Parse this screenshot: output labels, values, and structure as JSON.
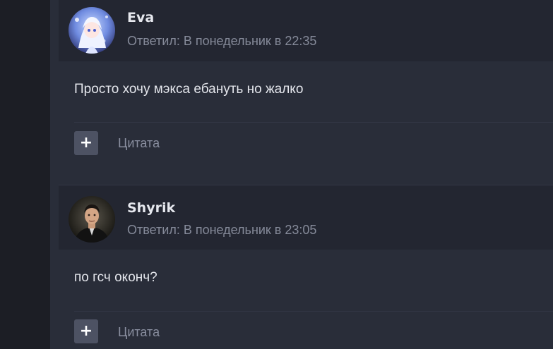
{
  "posts": [
    {
      "author": "Eva",
      "replied": "Ответил: В понедельник в 22:35",
      "message": "Просто хочу мэкса ебануть но жалко",
      "plus_label": "+",
      "quote_label": "Цитата"
    },
    {
      "author": "Shyrik",
      "replied": "Ответил: В понедельник в 23:05",
      "message": "по гсч оконч?",
      "plus_label": "+",
      "quote_label": "Цитата"
    }
  ],
  "colors": {
    "page_bg": "#292d39",
    "header_bg": "#232631",
    "gutter_bg": "#1c1e25",
    "button_bg": "#4d5263",
    "author_text": "#e6e8ee",
    "meta_text": "#858a99"
  },
  "icons": {
    "plus": "plus-icon"
  }
}
